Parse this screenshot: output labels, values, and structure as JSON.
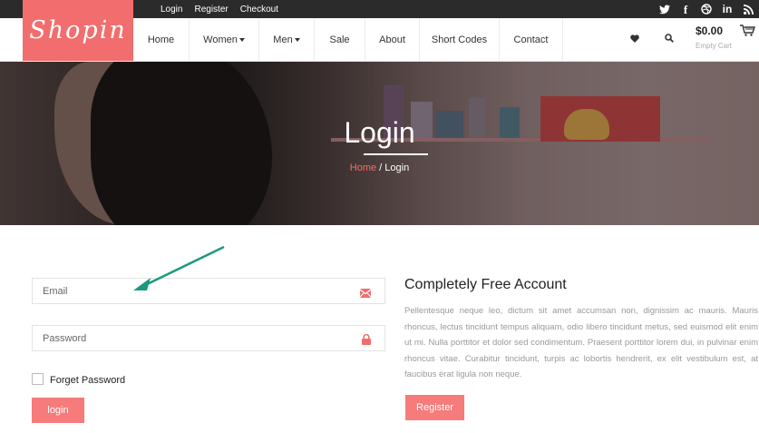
{
  "topbar": {
    "links": [
      "Login",
      "Register",
      "Checkout"
    ],
    "social": [
      {
        "icon": "twitter-icon",
        "glyph": "🐦"
      },
      {
        "icon": "facebook-icon",
        "glyph": "f"
      },
      {
        "icon": "dribbble-icon",
        "glyph": "⊕"
      },
      {
        "icon": "linkedin-icon",
        "glyph": "in"
      },
      {
        "icon": "rss-icon",
        "glyph": ")"
      }
    ]
  },
  "brand": {
    "logo_text": "Shopin",
    "accent": "#f26d6d"
  },
  "nav": {
    "items": [
      {
        "label": "Home",
        "dropdown": false
      },
      {
        "label": "Women",
        "dropdown": true
      },
      {
        "label": "Men",
        "dropdown": true
      },
      {
        "label": "Sale",
        "dropdown": false
      },
      {
        "label": "About",
        "dropdown": false
      },
      {
        "label": "Short Codes",
        "dropdown": false
      },
      {
        "label": "Contact",
        "dropdown": false
      }
    ],
    "wishlist_icon": "heart-icon",
    "search_icon": "search-icon"
  },
  "cart": {
    "amount": "$0.00",
    "status": "Empty Cart",
    "icon": "cart-icon"
  },
  "banner": {
    "title": "Login",
    "breadcrumb": {
      "home": "Home",
      "separator": "/",
      "current": "Login"
    }
  },
  "login_form": {
    "email_placeholder": "Email",
    "password_placeholder": "Password",
    "forget_label": "Forget Password",
    "submit_label": "login"
  },
  "account": {
    "title": "Completely Free Account",
    "text": "Pellentesque neque leo, dictum sit amet accumsan non, dignissim ac mauris. Mauris rhoncus, lectus tincidunt tempus aliquam, odio libero tincidunt metus, sed euismod elit enim ut mi. Nulla porttitor et dolor sed condimentum. Praesent porttitor lorem dui, in pulvinar enim rhoncus vitae. Curabitur tincidunt, turpis ac lobortis hendrerit, ex elit vestibulum est, at faucibus erat ligula non neque.",
    "register_label": "Register"
  },
  "annotation": {
    "arrow_color": "#1a9a7e"
  }
}
